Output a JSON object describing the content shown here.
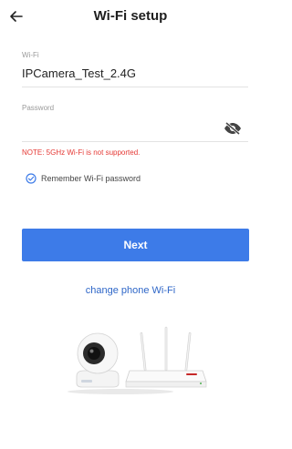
{
  "header": {
    "title": "Wi-Fi setup",
    "back_icon": "arrow-left-icon"
  },
  "wifi": {
    "label": "Wi-Fi",
    "value": "IPCamera_Test_2.4G"
  },
  "password": {
    "label": "Password",
    "value": "",
    "visibility_icon": "eye-off-icon"
  },
  "note": "NOTE: 5GHz Wi-Fi is not supported.",
  "remember": {
    "label": "Remember Wi-Fi password",
    "checked": true,
    "icon": "check-circle-icon"
  },
  "actions": {
    "next_label": "Next",
    "change_wifi_label": "change phone Wi-Fi"
  },
  "colors": {
    "accent": "#3d7be8",
    "link": "#2f67c8",
    "warning": "#e53935"
  }
}
